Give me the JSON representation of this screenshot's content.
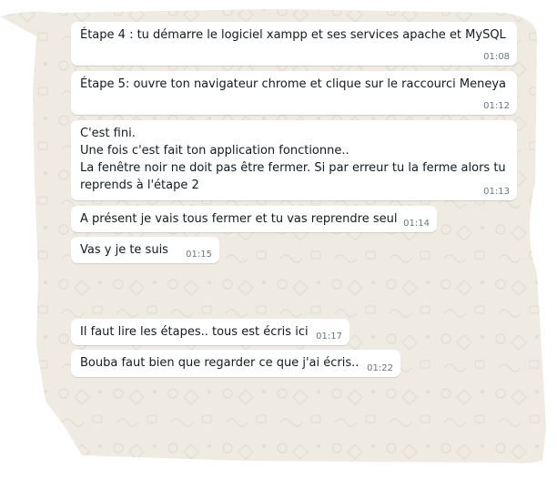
{
  "chat": {
    "messages": [
      {
        "text": "Étape 4 : tu démarre le logiciel xampp et ses services apache et MySQL",
        "time": "01:08"
      },
      {
        "text": "Étape 5: ouvre ton navigateur chrome et clique sur le raccourci Meneya",
        "time": "01:12"
      },
      {
        "text": "C'est fini.\nUne fois c'est fait ton application fonctionne..\nLa fenêtre noir ne doit pas être fermer. Si par erreur tu la ferme alors tu\nreprends à l'étape 2",
        "time": "01:13"
      },
      {
        "text": "A présent je vais tous fermer et tu vas reprendre seul",
        "time": "01:14"
      },
      {
        "text": "Vas y je te suis",
        "time": "01:15"
      },
      {
        "text": "Il faut lire les étapes.. tous est écris ici",
        "time": "01:17"
      },
      {
        "text": "Bouba faut bien que regarder ce que j'ai écris..",
        "time": "01:22"
      }
    ]
  },
  "colors": {
    "chat_background": "#efeae2",
    "bubble": "#ffffff",
    "time": "#667781"
  }
}
